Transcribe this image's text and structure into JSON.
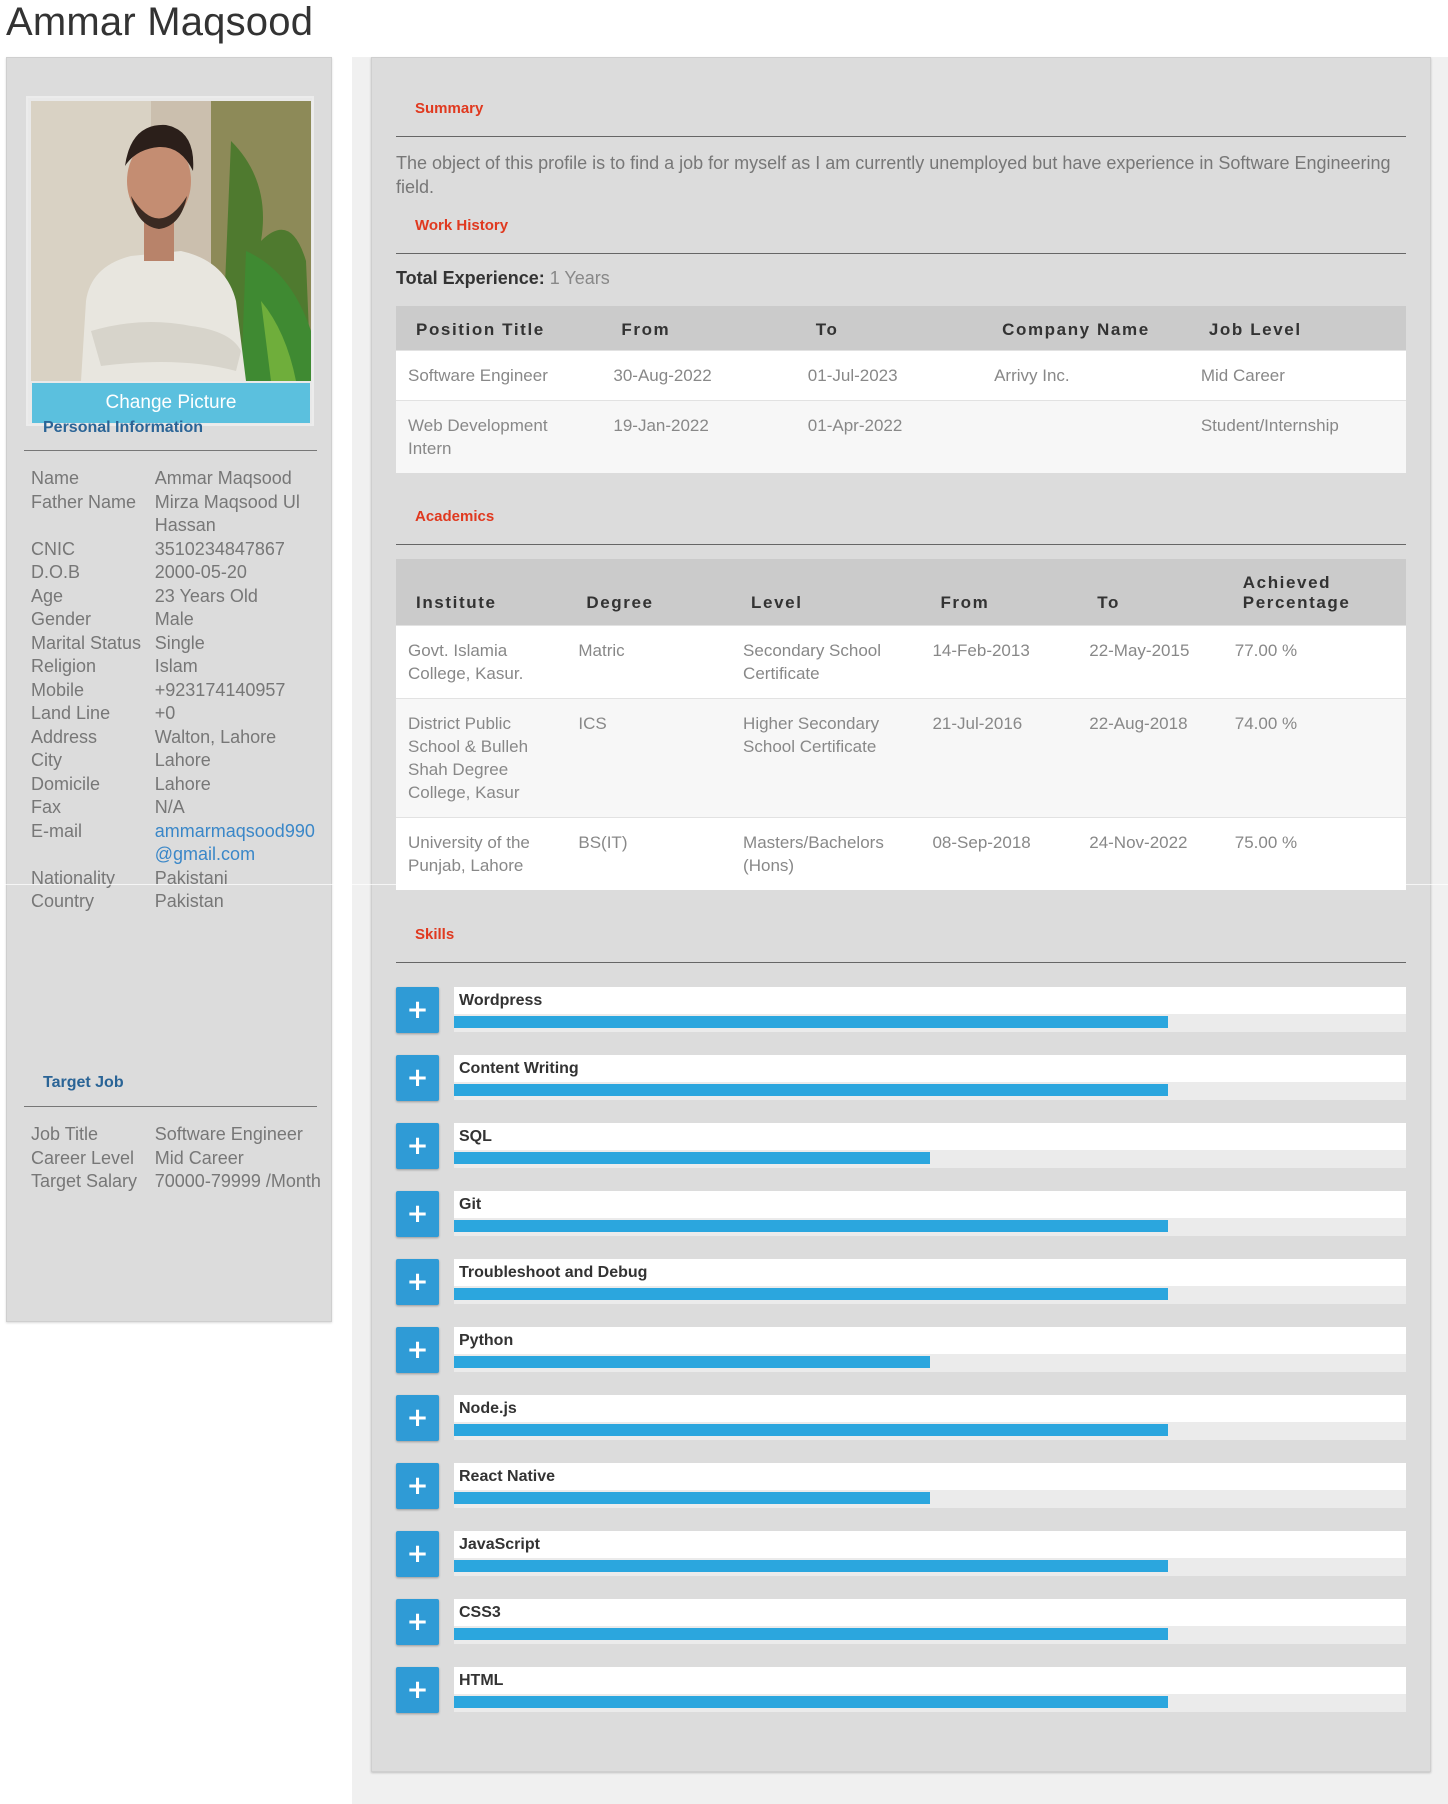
{
  "page_title": "Ammar Maqsood",
  "sidebar": {
    "change_picture_label": "Change Picture",
    "personal_heading": "Personal Information",
    "personal": [
      {
        "k": "Name",
        "v": "Ammar Maqsood"
      },
      {
        "k": "Father Name",
        "v": "Mirza Maqsood Ul Hassan"
      },
      {
        "k": "CNIC",
        "v": "3510234847867"
      },
      {
        "k": "D.O.B",
        "v": "2000-05-20"
      },
      {
        "k": "Age",
        "v": "23 Years Old"
      },
      {
        "k": "Gender",
        "v": "Male"
      },
      {
        "k": "Marital Status",
        "v": "Single"
      },
      {
        "k": "Religion",
        "v": "Islam"
      },
      {
        "k": "Mobile",
        "v": "+923174140957"
      },
      {
        "k": "Land Line",
        "v": "+0"
      },
      {
        "k": "Address",
        "v": "Walton, Lahore"
      },
      {
        "k": "City",
        "v": "Lahore"
      },
      {
        "k": "Domicile",
        "v": "Lahore"
      },
      {
        "k": "Fax",
        "v": "N/A"
      },
      {
        "k": "E-mail",
        "v": "ammarmaqsood990@gmail.com",
        "link": true
      },
      {
        "k": "Nationality",
        "v": "Pakistani"
      },
      {
        "k": "Country",
        "v": "Pakistan"
      }
    ],
    "target_heading": "Target Job",
    "target": [
      {
        "k": "Job Title",
        "v": "Software Engineer"
      },
      {
        "k": "Career Level",
        "v": "Mid Career"
      },
      {
        "k": "Target Salary",
        "v": "70000-79999 /Month"
      }
    ]
  },
  "summary": {
    "heading": "Summary",
    "text": "The object of this profile is to find a job for myself as I am currently unemployed but have experience in Software Engineering field."
  },
  "work_history": {
    "heading": "Work History",
    "total_label": "Total Experience:",
    "total_value": "1 Years",
    "columns": [
      "Position Title",
      "From",
      "To",
      "Company Name",
      "Job Level"
    ],
    "rows": [
      [
        "Software Engineer",
        "30-Aug-2022",
        "01-Jul-2023",
        "Arrivy Inc.",
        "Mid Career"
      ],
      [
        "Web Development Intern",
        "19-Jan-2022",
        "01-Apr-2022",
        "",
        "Student/Internship"
      ]
    ]
  },
  "academics": {
    "heading": "Academics",
    "columns": [
      "Institute",
      "Degree",
      "Level",
      "From",
      "To",
      "Achieved Percentage"
    ],
    "rows": [
      [
        "Govt. Islamia College, Kasur.",
        "Matric",
        "Secondary School Certificate",
        "14-Feb-2013",
        "22-May-2015",
        "77.00 %"
      ],
      [
        "District Public School & Bulleh Shah Degree College, Kasur",
        "ICS",
        "Higher Secondary School Certificate",
        "21-Jul-2016",
        "22-Aug-2018",
        "74.00 %"
      ],
      [
        "University of the Punjab, Lahore",
        "BS(IT)",
        "Masters/Bachelors (Hons)",
        "08-Sep-2018",
        "24-Nov-2022",
        "75.00 %"
      ]
    ]
  },
  "skills": {
    "heading": "Skills",
    "button_label": "+",
    "items": [
      {
        "name": "Wordpress",
        "level": 0.75
      },
      {
        "name": "Content Writing",
        "level": 0.75
      },
      {
        "name": "SQL",
        "level": 0.5
      },
      {
        "name": "Git",
        "level": 0.75
      },
      {
        "name": "Troubleshoot and Debug",
        "level": 0.75
      },
      {
        "name": "Python",
        "level": 0.5
      },
      {
        "name": "Node.js",
        "level": 0.75
      },
      {
        "name": "React Native",
        "level": 0.5
      },
      {
        "name": "JavaScript",
        "level": 0.75
      },
      {
        "name": "CSS3",
        "level": 0.75
      },
      {
        "name": "HTML",
        "level": 0.75
      }
    ]
  },
  "colors": {
    "accent_heading": "#e0391f",
    "side_heading": "#2a6496",
    "skill_bar": "#2ba6de",
    "button": "#5bc0de"
  }
}
